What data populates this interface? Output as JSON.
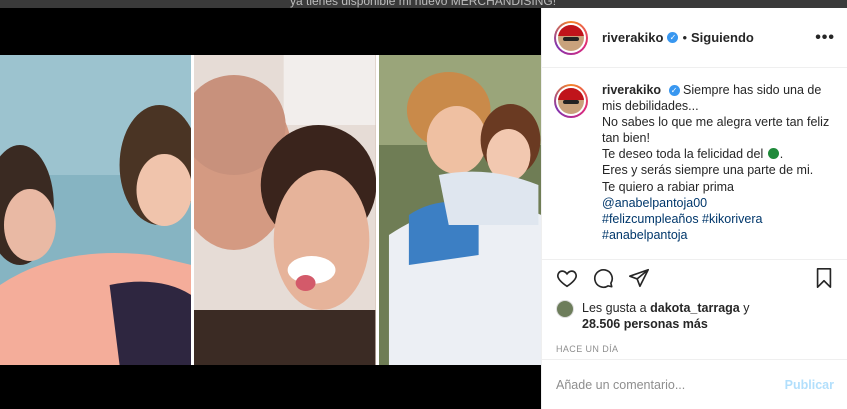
{
  "backdrop": {
    "text": "ya tienes disponible mi nuevo MERCHANDISING!"
  },
  "header": {
    "username": "riverakiko",
    "verified_glyph": "✓",
    "separator": "•",
    "follow_status": "Siguiendo",
    "more_label": "•••"
  },
  "caption": {
    "username": "riverakiko",
    "line1": "Siempre has sido una de mis debilidades...",
    "line2": "No sabes lo que me alegra verte tan feliz tan bien!",
    "line3_before": "Te deseo toda la felicidad del",
    "line3_after": ".",
    "line4": "Eres y serás siempre una parte de mi.",
    "line5": "Te quiero a rabiar prima",
    "mention": "@anabelpantoja00",
    "hashtags1": "#felizcumpleaños #kikorivera",
    "hashtags2": "#anabelpantoja"
  },
  "actions": {
    "like_icon": "heart-icon",
    "comment_icon": "comment-icon",
    "share_icon": "share-icon",
    "save_icon": "bookmark-icon"
  },
  "likes": {
    "prefix": "Les gusta a",
    "user": "dakota_tarraga",
    "conj": "y",
    "count": "28.506 personas más"
  },
  "timestamp": "HACE UN DÍA",
  "comment": {
    "placeholder": "Añade un comentario...",
    "publish_label": "Publicar"
  },
  "colors": {
    "verified": "#3897f0",
    "link": "#00376b",
    "publish_disabled": "#b2dffc"
  }
}
